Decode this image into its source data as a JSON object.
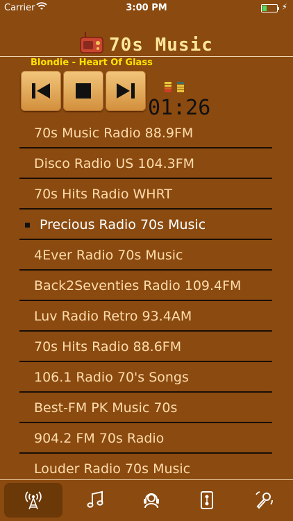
{
  "status_bar": {
    "carrier": "Carrier",
    "time": "3:00 PM"
  },
  "header": {
    "title": "70s Music"
  },
  "now_playing": "Blondie - Heart Of Glass",
  "timer": "01:26",
  "stations": [
    "70s Music Radio 88.9FM",
    "Disco Radio US 104.3FM",
    "70s Hits Radio WHRT",
    "Precious Radio 70s Music",
    "4Ever Radio 70s Music",
    "Back2Seventies Radio 109.4FM",
    "Luv Radio Retro 93.4AM",
    "70s Hits Radio 88.6FM",
    "106.1 Radio 70's Songs",
    "Best-FM PK Music 70s",
    "904.2 FM 70s Radio",
    "Louder Radio 70s Music"
  ],
  "active_station_index": 3,
  "tabs": [
    {
      "icon": "radio-tower-icon",
      "selected": true
    },
    {
      "icon": "music-note-icon",
      "selected": false
    },
    {
      "icon": "headset-icon",
      "selected": false
    },
    {
      "icon": "cassette-icon",
      "selected": false
    },
    {
      "icon": "microphone-icon",
      "selected": false
    }
  ],
  "colors": {
    "background": "#8a4a10",
    "title": "#ffe79a",
    "now_playing": "#ffe400",
    "station_text": "#ffdcac",
    "active_station_text": "#ffffff"
  }
}
